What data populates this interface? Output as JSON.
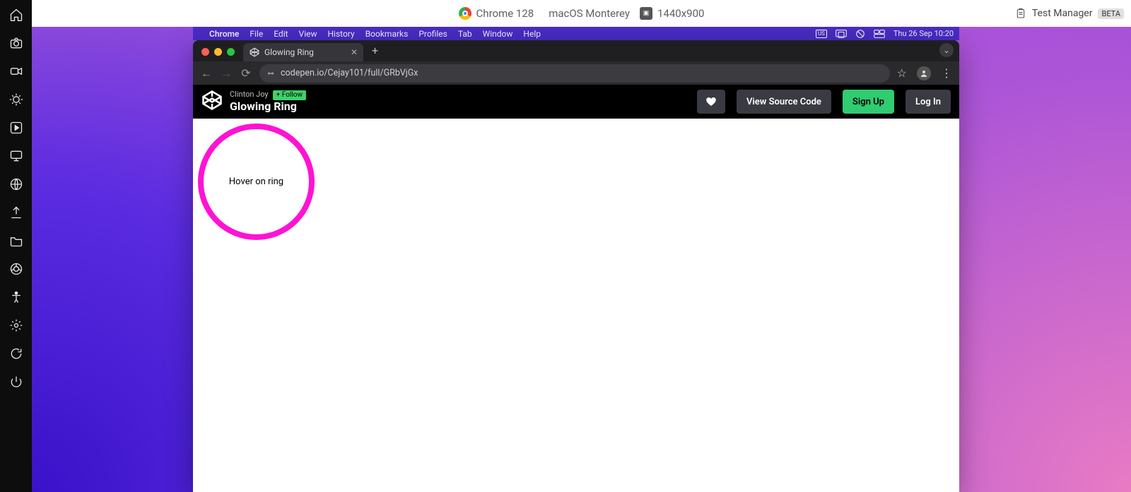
{
  "harness": {
    "browser_label": "Chrome 128",
    "os_label": "macOS Monterey",
    "resolution_label": "1440x900",
    "test_manager_label": "Test Manager",
    "beta_label": "BETA"
  },
  "mac_menu": {
    "app": "Chrome",
    "items": [
      "File",
      "Edit",
      "View",
      "History",
      "Bookmarks",
      "Profiles",
      "Tab",
      "Window",
      "Help"
    ],
    "keyboard": "US",
    "datetime": "Thu 26 Sep  10:20"
  },
  "chrome": {
    "tab_title": "Glowing Ring",
    "url": "codepen.io/Cejay101/full/GRbVjGx"
  },
  "codepen": {
    "author": "Clinton Joy",
    "follow_label": "+ Follow",
    "pen_title": "Glowing Ring",
    "view_source_label": "View Source Code",
    "signup_label": "Sign Up",
    "login_label": "Log In"
  },
  "pen": {
    "ring_text": "Hover on ring"
  }
}
